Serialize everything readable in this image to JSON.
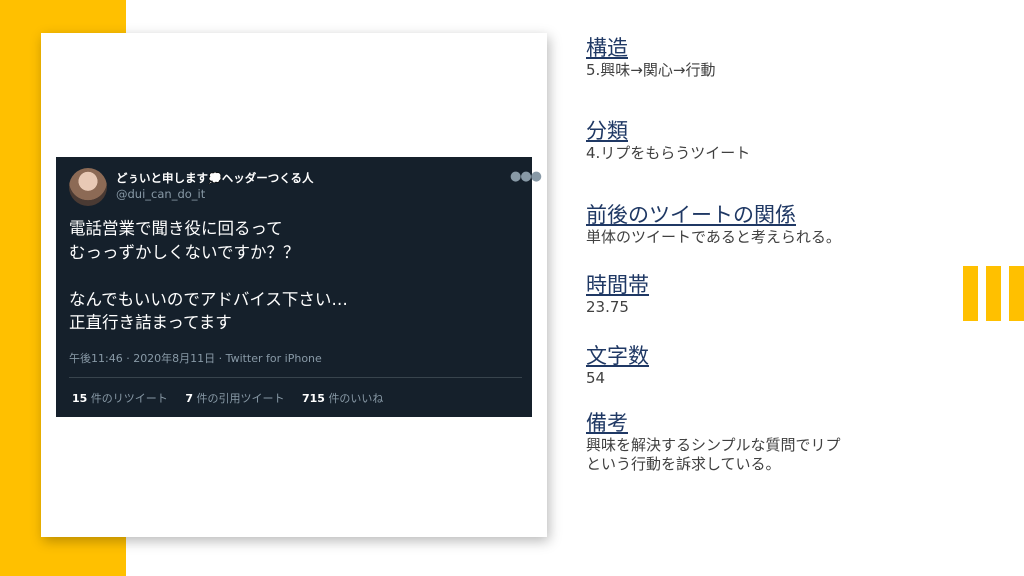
{
  "colors": {
    "accent": "#ffc000",
    "title": "#1f3864",
    "tweet_bg": "#15202b"
  },
  "tweet": {
    "display_name": "どぅいと申します",
    "display_name_suffix": "ヘッダーつくる人",
    "handle": "@dui_can_do_it",
    "text_lines": [
      "電話営業で聞き役に回るって",
      "むっっずかしくないですか？？",
      "",
      "なんでもいいのでアドバイス下さい…",
      "正直行き詰まってます"
    ],
    "meta": "午後11:46 · 2020年8月11日 · Twitter for iPhone",
    "stats": [
      {
        "count": "15",
        "label": "件のリツイート"
      },
      {
        "count": "7",
        "label": "件の引用ツイート"
      },
      {
        "count": "715",
        "label": "件のいいね"
      }
    ],
    "icons": {
      "more": "more-options-icon",
      "speech": "speech-bubble-icon",
      "avatar": "profile-photo"
    }
  },
  "info": [
    {
      "title": "構造",
      "value": [
        "5.興味→関心→行動"
      ]
    },
    {
      "title": "分類",
      "value": [
        "4.リプをもらうツイート"
      ]
    },
    {
      "title": "前後のツイートの関係",
      "value": [
        "単体のツイートであると考えられる。"
      ]
    },
    {
      "title": "時間帯",
      "value": [
        "23.75"
      ]
    },
    {
      "title": "文字数",
      "value": [
        "54"
      ]
    },
    {
      "title": "備考",
      "value": [
        "興味を解決するシンプルな質問でリプ",
        "という行動を訴求している。"
      ]
    }
  ]
}
